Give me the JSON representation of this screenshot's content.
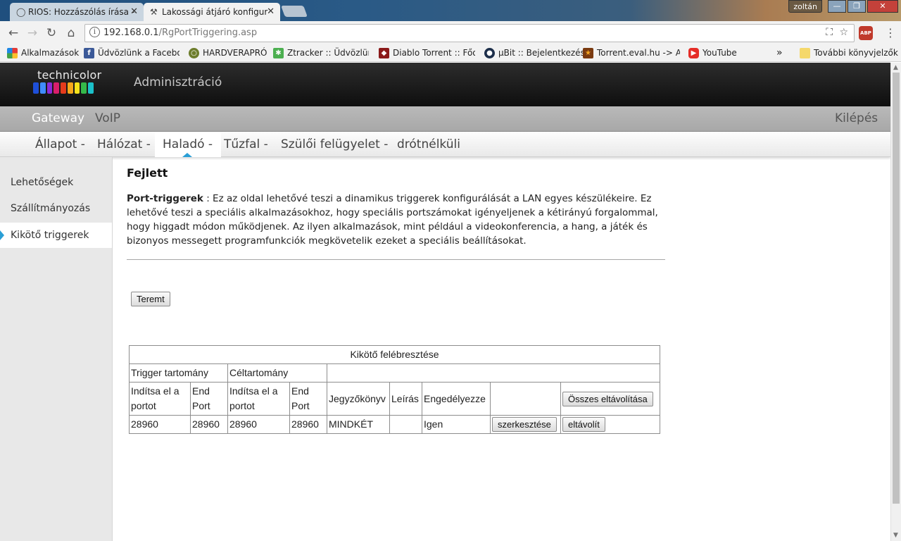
{
  "browser": {
    "tabs": [
      {
        "title": "RIOS: Hozzászólás írása -",
        "icon": "page-icon"
      },
      {
        "title": "Lakossági átjáró konfigur",
        "icon": "tools-icon"
      }
    ],
    "user": "zoltán",
    "url_host": "192.168.0.1",
    "url_path": "/RgPortTriggering.asp",
    "abp_label": "ABP",
    "bookmarks": [
      {
        "label": "Alkalmazások",
        "icon": "apps-grid-icon"
      },
      {
        "label": "Üdvözlünk a Facebo",
        "icon": "facebook-icon"
      },
      {
        "label": "HARDVERAPRÓ",
        "icon": "hardverapro-icon"
      },
      {
        "label": "Ztracker :: Üdvözlünk",
        "icon": "ztracker-icon"
      },
      {
        "label": "Diablo Torrent :: Főol",
        "icon": "diablo-icon"
      },
      {
        "label": "µBit :: Bejelentkezés",
        "icon": "ubit-icon"
      },
      {
        "label": "Torrent.eval.hu -> A t",
        "icon": "star-icon"
      },
      {
        "label": "YouTube",
        "icon": "youtube-icon"
      }
    ],
    "more_bookmarks": "»",
    "other_bookmarks": "További könyvjelzők"
  },
  "header": {
    "brand": "technicolor",
    "title": "Adminisztráció"
  },
  "nav_primary": {
    "items": [
      "Gateway",
      "VoIP"
    ],
    "logout": "Kilépés"
  },
  "nav_secondary": {
    "items": [
      "Állapot -",
      "Hálózat -",
      "Haladó -",
      "Tűzfal -",
      "Szülői felügyelet -",
      "drótnélküli"
    ],
    "active_index": 2
  },
  "sidebar": {
    "items": [
      "Lehetőségek",
      "Szállítmányozás",
      "Kikötő triggerek"
    ],
    "active_index": 2
  },
  "page": {
    "heading": "Fejlett",
    "desc_label": "Port-triggerek",
    "desc_sep": " : ",
    "desc_text": "Ez az oldal lehetővé teszi a dinamikus triggerek konfigurálását a LAN egyes készülékeire. Ez lehetővé teszi a speciális alkalmazásokhoz, hogy speciális portszámokat igényeljenek a kétirányú forgalommal, hogy higgadt módon működjenek. Az ilyen alkalmazások, mint például a videokonferencia, a hang, a játék és bizonyos messegett programfunkciók megkövetelik ezeket a speciális beállításokat.",
    "create_button": "Teremt"
  },
  "table": {
    "title": "Kikötő felébresztése",
    "group_trigger": "Trigger tartomány",
    "group_target": "Céltartomány",
    "col_start": "Indítsa el a portot",
    "col_end": "End Port",
    "col_start2": "Indítsa el a portot",
    "col_end2": "End Port",
    "col_protocol": "Jegyzőkönyv",
    "col_desc": "Leírás",
    "col_enable": "Engedélyezze",
    "remove_all_button": "Összes eltávolítása",
    "rows": [
      {
        "trigger_start": "28960",
        "trigger_end": "28960",
        "target_start": "28960",
        "target_end": "28960",
        "protocol": "MINDKÉT",
        "description": "",
        "enabled": "Igen",
        "edit_button": "szerkesztése",
        "remove_button": "eltávolít"
      }
    ]
  },
  "colors": {
    "accent": "#2a9fd6",
    "header_dark": "#111111",
    "nav_gray": "#b0b0b0",
    "sidebar_bg": "#e8e8e8"
  }
}
